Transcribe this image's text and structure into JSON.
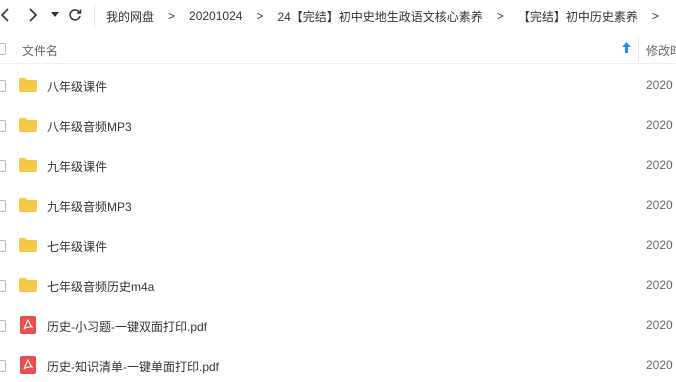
{
  "nav": {
    "back_icon": "chevron-left-icon",
    "forward_icon": "chevron-right-icon",
    "menu_icon": "caret-down-icon",
    "refresh_icon": "refresh-icon"
  },
  "breadcrumb": [
    "我的网盘",
    "20201024",
    "24【完结】初中史地生政语文核心素养",
    "【完结】初中历史素养"
  ],
  "breadcrumb_separator": ">",
  "header": {
    "name": "文件名",
    "modified": "修改时"
  },
  "files": [
    {
      "name": "八年级课件",
      "type": "folder",
      "date": "2020"
    },
    {
      "name": "八年级音频MP3",
      "type": "folder",
      "date": "2020"
    },
    {
      "name": "九年级课件",
      "type": "folder",
      "date": "2020"
    },
    {
      "name": "九年级音频MP3",
      "type": "folder",
      "date": "2020"
    },
    {
      "name": "七年级课件",
      "type": "folder",
      "date": "2020"
    },
    {
      "name": "七年级音频历史m4a",
      "type": "folder",
      "date": "2020"
    },
    {
      "name": "历史-小习题-一键双面打印.pdf",
      "type": "pdf",
      "date": "2020"
    },
    {
      "name": "历史-知识清单-一键单面打印.pdf",
      "type": "pdf",
      "date": "2020"
    }
  ],
  "colors": {
    "folder": "#f7c948",
    "pdf": "#e94f4f",
    "accent": "#2b8ce6"
  }
}
